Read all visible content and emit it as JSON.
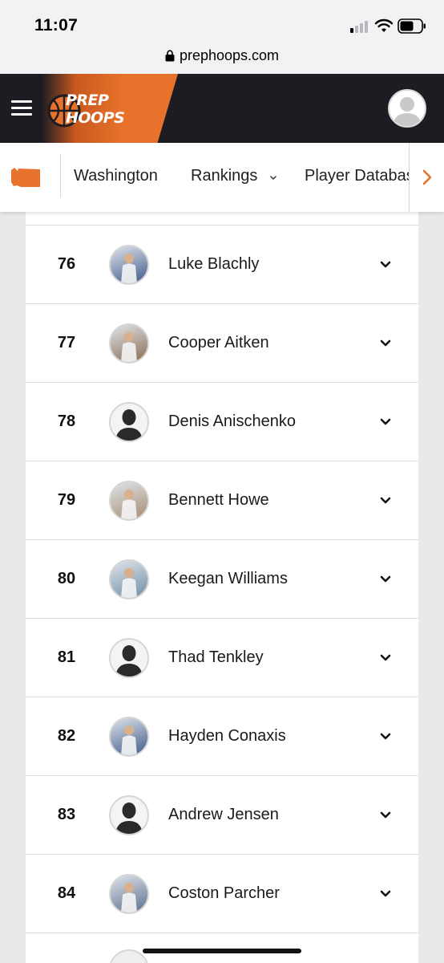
{
  "status_bar": {
    "time": "11:07",
    "icons": [
      "cellular-signal-icon",
      "wifi-icon",
      "battery-icon"
    ]
  },
  "browser": {
    "url": "prephoops.com"
  },
  "header": {
    "logo_line1": "PREP",
    "logo_line2": "HOOPS",
    "brand_colors": {
      "orange": "#e8722b",
      "dark": "#1d1c22"
    }
  },
  "sub_nav": {
    "state_icon": "washington-state-icon",
    "items": [
      {
        "label": "Washington"
      },
      {
        "label": "Rankings"
      },
      {
        "label": "Player Database"
      }
    ]
  },
  "players": [
    {
      "rank": "76",
      "name": "Luke Blachly",
      "photo": "photo"
    },
    {
      "rank": "77",
      "name": "Cooper Aitken",
      "photo": "photo"
    },
    {
      "rank": "78",
      "name": "Denis Anischenko",
      "photo": "placeholder"
    },
    {
      "rank": "79",
      "name": "Bennett Howe",
      "photo": "photo"
    },
    {
      "rank": "80",
      "name": "Keegan Williams",
      "photo": "photo"
    },
    {
      "rank": "81",
      "name": "Thad Tenkley",
      "photo": "placeholder"
    },
    {
      "rank": "82",
      "name": "Hayden Conaxis",
      "photo": "photo"
    },
    {
      "rank": "83",
      "name": "Andrew Jensen",
      "photo": "placeholder"
    },
    {
      "rank": "84",
      "name": "Coston Parcher",
      "photo": "photo"
    }
  ]
}
